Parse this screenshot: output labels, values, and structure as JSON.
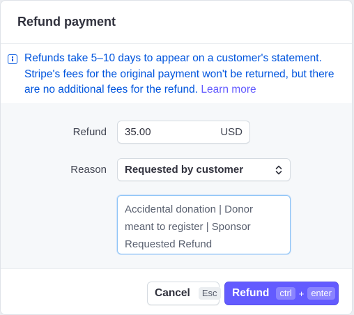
{
  "dialog": {
    "title": "Refund payment"
  },
  "notice": {
    "icon": "info-icon",
    "text": "Refunds take 5–10 days to appear on a customer's statement. Stripe's fees for the original payment won't be returned, but there are no additional fees for the refund.",
    "link": "Learn more"
  },
  "form": {
    "refund_label": "Refund",
    "amount": "35.00",
    "currency": "USD",
    "reason_label": "Reason",
    "reason_value": "Requested by customer",
    "note_text": "Accidental donation | Donor meant to register | Sponsor Requested Refund"
  },
  "footer": {
    "cancel_label": "Cancel",
    "cancel_shortcut": "Esc",
    "refund_label": "Refund",
    "refund_shortcut_key1": "ctrl",
    "refund_shortcut_plus": "+",
    "refund_shortcut_key2": "enter"
  },
  "colors": {
    "accent": "#635bff",
    "info": "#0055de"
  }
}
